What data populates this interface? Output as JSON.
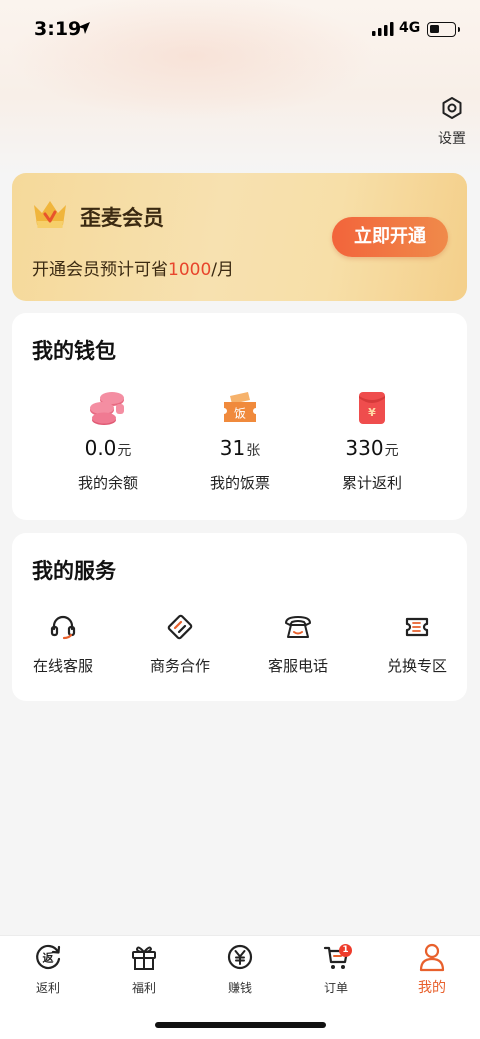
{
  "status_bar": {
    "time": "3:19",
    "network": "4G"
  },
  "header": {
    "settings_label": "设置"
  },
  "vip": {
    "title": "歪麦会员",
    "desc_prefix": "开通会员预计可省",
    "desc_amount": "1000",
    "desc_suffix": "/月",
    "button_label": "立即开通"
  },
  "wallet": {
    "title": "我的钱包",
    "items": [
      {
        "value": "0.0",
        "unit": "元",
        "label": "我的余额",
        "icon": "coins-icon"
      },
      {
        "value": "31",
        "unit": "张",
        "label": "我的饭票",
        "icon": "meal-ticket-icon"
      },
      {
        "value": "330",
        "unit": "元",
        "label": "累计返利",
        "icon": "red-envelope-icon"
      }
    ]
  },
  "services": {
    "title": "我的服务",
    "items": [
      {
        "label": "在线客服",
        "icon": "headset-icon"
      },
      {
        "label": "商务合作",
        "icon": "card-icon"
      },
      {
        "label": "客服电话",
        "icon": "telephone-icon"
      },
      {
        "label": "兑换专区",
        "icon": "coupon-icon"
      }
    ]
  },
  "tabbar": {
    "items": [
      {
        "label": "返利",
        "icon": "rebate-icon"
      },
      {
        "label": "福利",
        "icon": "gift-icon"
      },
      {
        "label": "赚钱",
        "icon": "yen-icon"
      },
      {
        "label": "订单",
        "icon": "cart-icon",
        "badge": "1"
      },
      {
        "label": "我的",
        "icon": "user-icon"
      }
    ],
    "active_index": 4
  },
  "colors": {
    "accent": "#e8602c",
    "highlight": "#e8452c",
    "vip_gold": "#f5d99a"
  }
}
